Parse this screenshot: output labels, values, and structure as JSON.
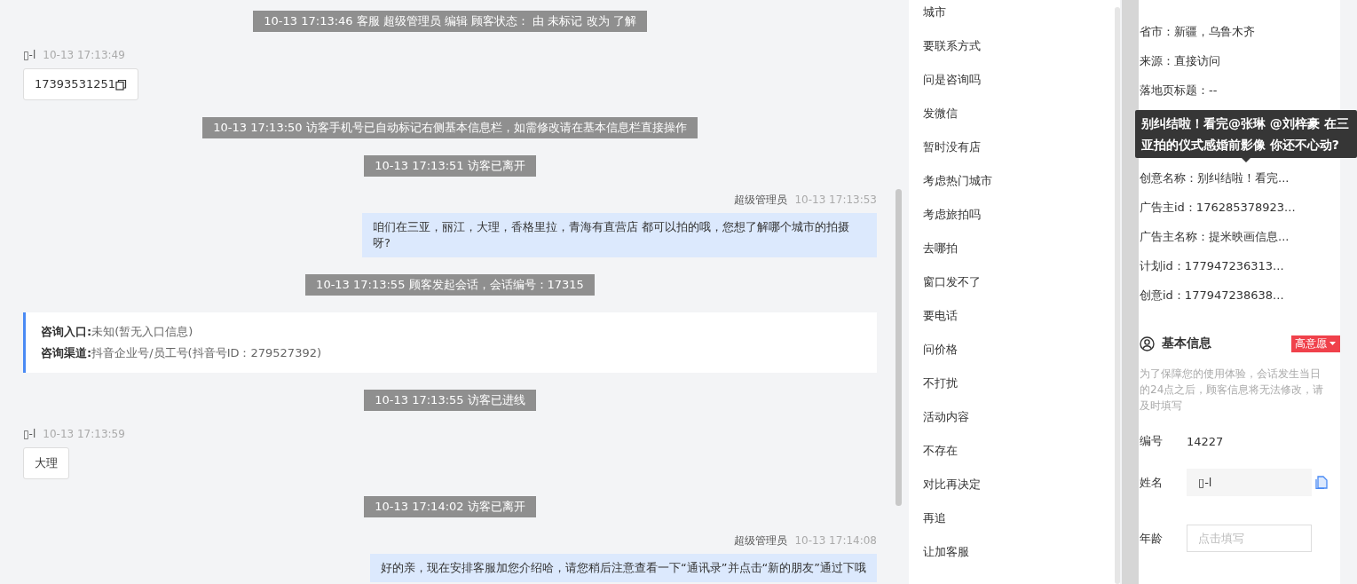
{
  "chat": {
    "messages": [
      {
        "kind": "system",
        "text": "10-13 17:13:46 客服 超级管理员 编辑 顾客状态： 由 未标记 改为 了解"
      },
      {
        "kind": "visitor",
        "sender": "▯-l",
        "time": "10-13 17:13:49",
        "text": "17393531251",
        "copy": true
      },
      {
        "kind": "system",
        "text": "10-13 17:13:50 访客手机号已自动标记右侧基本信息栏，如需修改请在基本信息栏直接操作"
      },
      {
        "kind": "system",
        "text": "10-13 17:13:51 访客已离开"
      },
      {
        "kind": "agent",
        "sender": "超级管理员",
        "time": "10-13 17:13:53",
        "text": "咱们在三亚，丽江，大理，香格里拉，青海有直营店 都可以拍的哦，您想了解哪个城市的拍摄呀?"
      },
      {
        "kind": "system",
        "text": "10-13 17:13:55 顾客发起会话，会话编号：17315"
      },
      {
        "kind": "info",
        "rows": [
          {
            "label": "咨询入口:",
            "value": "未知(暂无入口信息)"
          },
          {
            "label": "咨询渠道:",
            "value": "抖音企业号/员工号(抖音号ID：279527392)"
          }
        ]
      },
      {
        "kind": "system",
        "text": "10-13 17:13:55 访客已进线"
      },
      {
        "kind": "visitor",
        "sender": "▯-l",
        "time": "10-13 17:13:59",
        "text": "大理",
        "copy": false
      },
      {
        "kind": "system",
        "text": "10-13 17:14:02 访客已离开"
      },
      {
        "kind": "agent",
        "sender": "超级管理员",
        "time": "10-13 17:14:08",
        "text": "好的亲，现在安排客服加您介绍哈，请您稍后注意查看一下“通讯录”并点击“新的朋友”通过下哦"
      }
    ]
  },
  "quick_replies": [
    "城市",
    "要联系方式",
    "问是咨询吗",
    "发微信",
    "暂时没有店",
    "考虑热门城市",
    "考虑旅拍吗",
    "去哪拍",
    "窗口发不了",
    "要电话",
    "问价格",
    "不打扰",
    "活动内容",
    "不存在",
    "对比再决定",
    "再追",
    "让加客服"
  ],
  "visitor_info": {
    "rows": [
      {
        "text": "省市：新疆，乌鲁木齐"
      },
      {
        "text": "来源：直接访问"
      },
      {
        "text": "落地页标题：--"
      },
      {
        "text": ""
      },
      {
        "text": ""
      },
      {
        "text": "创意名称：别纠结啦！看完..."
      },
      {
        "text": "广告主id：176285378923..."
      },
      {
        "text": "广告主名称：提米映画信息..."
      },
      {
        "text": "计划id：177947236313..."
      },
      {
        "text": "创意id：177947238638..."
      }
    ],
    "tooltip": "别纠结啦！看完@张琳 @刘梓豪 在三亚拍的仪式感婚前影像 你还不心动?"
  },
  "basic_info": {
    "title": "基本信息",
    "badge": "高意愿",
    "note": "为了保障您的使用体验，会话发生当日的24点之后，顾客信息将无法修改，请及时填写",
    "fields": [
      {
        "kind": "text",
        "label": "编号",
        "value": "14227"
      },
      {
        "kind": "input",
        "label": "姓名",
        "value": "▯-l",
        "disabled": true,
        "copy": true
      },
      {
        "kind": "input",
        "label": "年龄",
        "placeholder": "点击填写",
        "disabled": false,
        "copy": false
      }
    ]
  }
}
